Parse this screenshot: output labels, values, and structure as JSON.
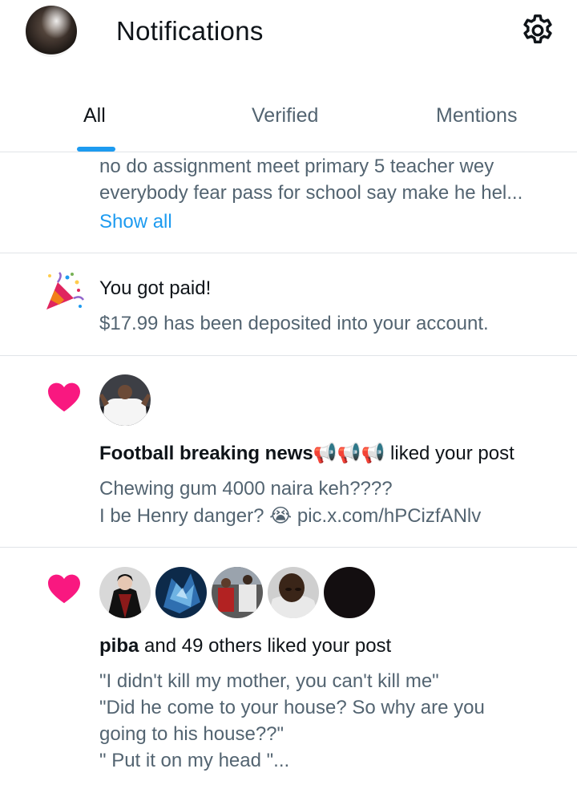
{
  "header": {
    "title": "Notifications"
  },
  "tabs": [
    {
      "label": "All"
    },
    {
      "label": "Verified"
    },
    {
      "label": "Mentions"
    }
  ],
  "notif1": {
    "line1": "no do assignment meet primary 5 teacher wey",
    "line2": "everybody fear pass for school say make he hel...",
    "show_all": "Show all"
  },
  "notif2": {
    "title": "You got paid!",
    "body": "$17.99 has been deposited into your account."
  },
  "notif3": {
    "user": "Football breaking news📢📢📢",
    "action": " liked your post",
    "line1": "Chewing gum 4000 naira keh????",
    "line2": "I be Henry danger? 😭 ",
    "link": "pic.x.com/hPCizfANlv"
  },
  "notif4": {
    "user": "piba",
    "action": " and 49 others liked your post",
    "line1": "\"I didn't kill my mother, you can't kill me\"",
    "line2": "\"Did he come to your house? So why are you",
    "line3": "going to his house??\"",
    "line4": "\" Put it on my head \"..."
  },
  "colors": {
    "accent": "#1d9bf0",
    "heart": "#f91880",
    "muted": "#536471"
  }
}
